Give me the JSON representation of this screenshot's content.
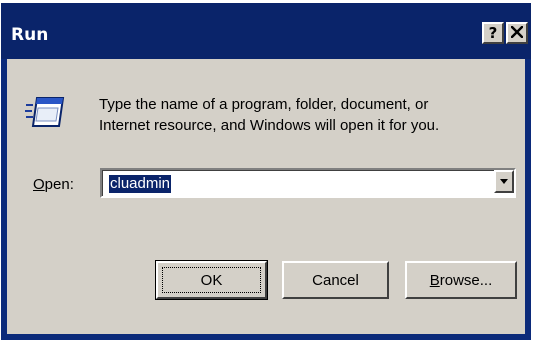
{
  "window": {
    "title": "Run",
    "help_button": "?",
    "close_button": "X"
  },
  "icon": {
    "name": "run-icon"
  },
  "description": {
    "line1": "Type the name of a program, folder, document, or",
    "line2": "Internet resource, and Windows will open it for you."
  },
  "open_field": {
    "label_accel": "O",
    "label_rest": "pen:",
    "value": "cluadmin"
  },
  "buttons": {
    "ok": "OK",
    "cancel": "Cancel",
    "browse_accel": "B",
    "browse_rest": "rowse..."
  },
  "colors": {
    "titlebar": "#0a246a",
    "face": "#d4d0c8",
    "selection": "#0a246a"
  }
}
